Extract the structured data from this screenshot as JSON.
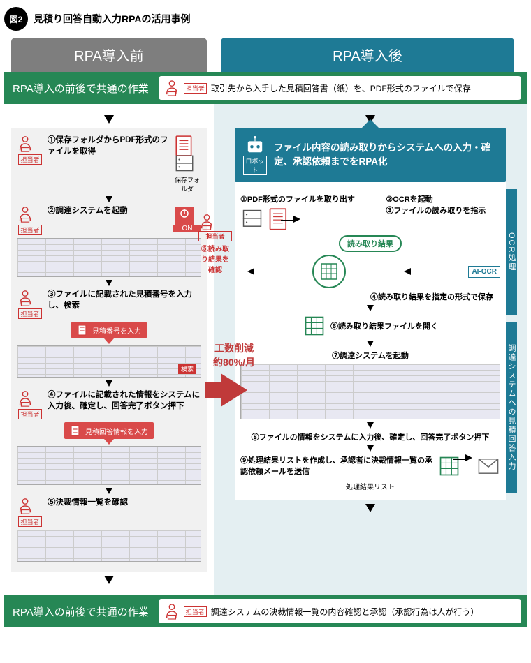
{
  "figure": {
    "badge": "図2",
    "title": "見積り回答自動入力RPAの活用事例"
  },
  "columns": {
    "before": "RPA導入前",
    "after": "RPA導入後"
  },
  "common_top": {
    "label": "RPA導入の前後で共通の作業",
    "operator": "担当者",
    "desc": "取引先から入手した見積回答書（紙）を、PDF形式のファイルで保存"
  },
  "before_steps": {
    "operator": "担当者",
    "s1": "①保存フォルダからPDF形式のファイルを取得",
    "folder": "保存フォルダ",
    "s2": "②調達システムを起動",
    "on": "ON",
    "s3": "③ファイルに記載された見積番号を入力し、検索",
    "red3": "見積番号を入力",
    "search": "検索",
    "s4": "④ファイルに記載された情報をシステムに入力後、確定し、回答完了ボタン押下",
    "red4": "見積回答情報を入力",
    "s5": "⑤決裁情報一覧を確認"
  },
  "center": {
    "line1": "工数削減",
    "line2": "約80%/月"
  },
  "robot": {
    "label": "ロボット",
    "text": "ファイル内容の読み取りからシステムへの入力・確定、承認依頼までをRPA化"
  },
  "after_steps": {
    "side1": "OCR処理",
    "side2": "調達システムへの見積回答入力",
    "s1": "①PDF形式のファイルを取り出す",
    "s2": "②OCRを起動",
    "s3": "③ファイルの読み取りを指示",
    "read_result": "読み取り結果",
    "ai_ocr": "AI-OCR",
    "s4": "④読み取り結果を指定の形式で保存",
    "operator": "担当者",
    "s5": "⑤読み取り結果を確認",
    "s6": "⑥読み取り結果ファイルを開く",
    "s7": "⑦調達システムを起動",
    "s8": "⑧ファイルの情報をシステムに入力後、確定し、回答完了ボタン押下",
    "s9": "⑨処理結果リストを作成し、承認者に決裁情報一覧の承認依頼メールを送信",
    "result_list": "処理結果リスト"
  },
  "common_bottom": {
    "label": "RPA導入の前後で共通の作業",
    "operator": "担当者",
    "desc": "調達システムの決裁情報一覧の内容確認と承認（承認行為は人が行う）"
  }
}
